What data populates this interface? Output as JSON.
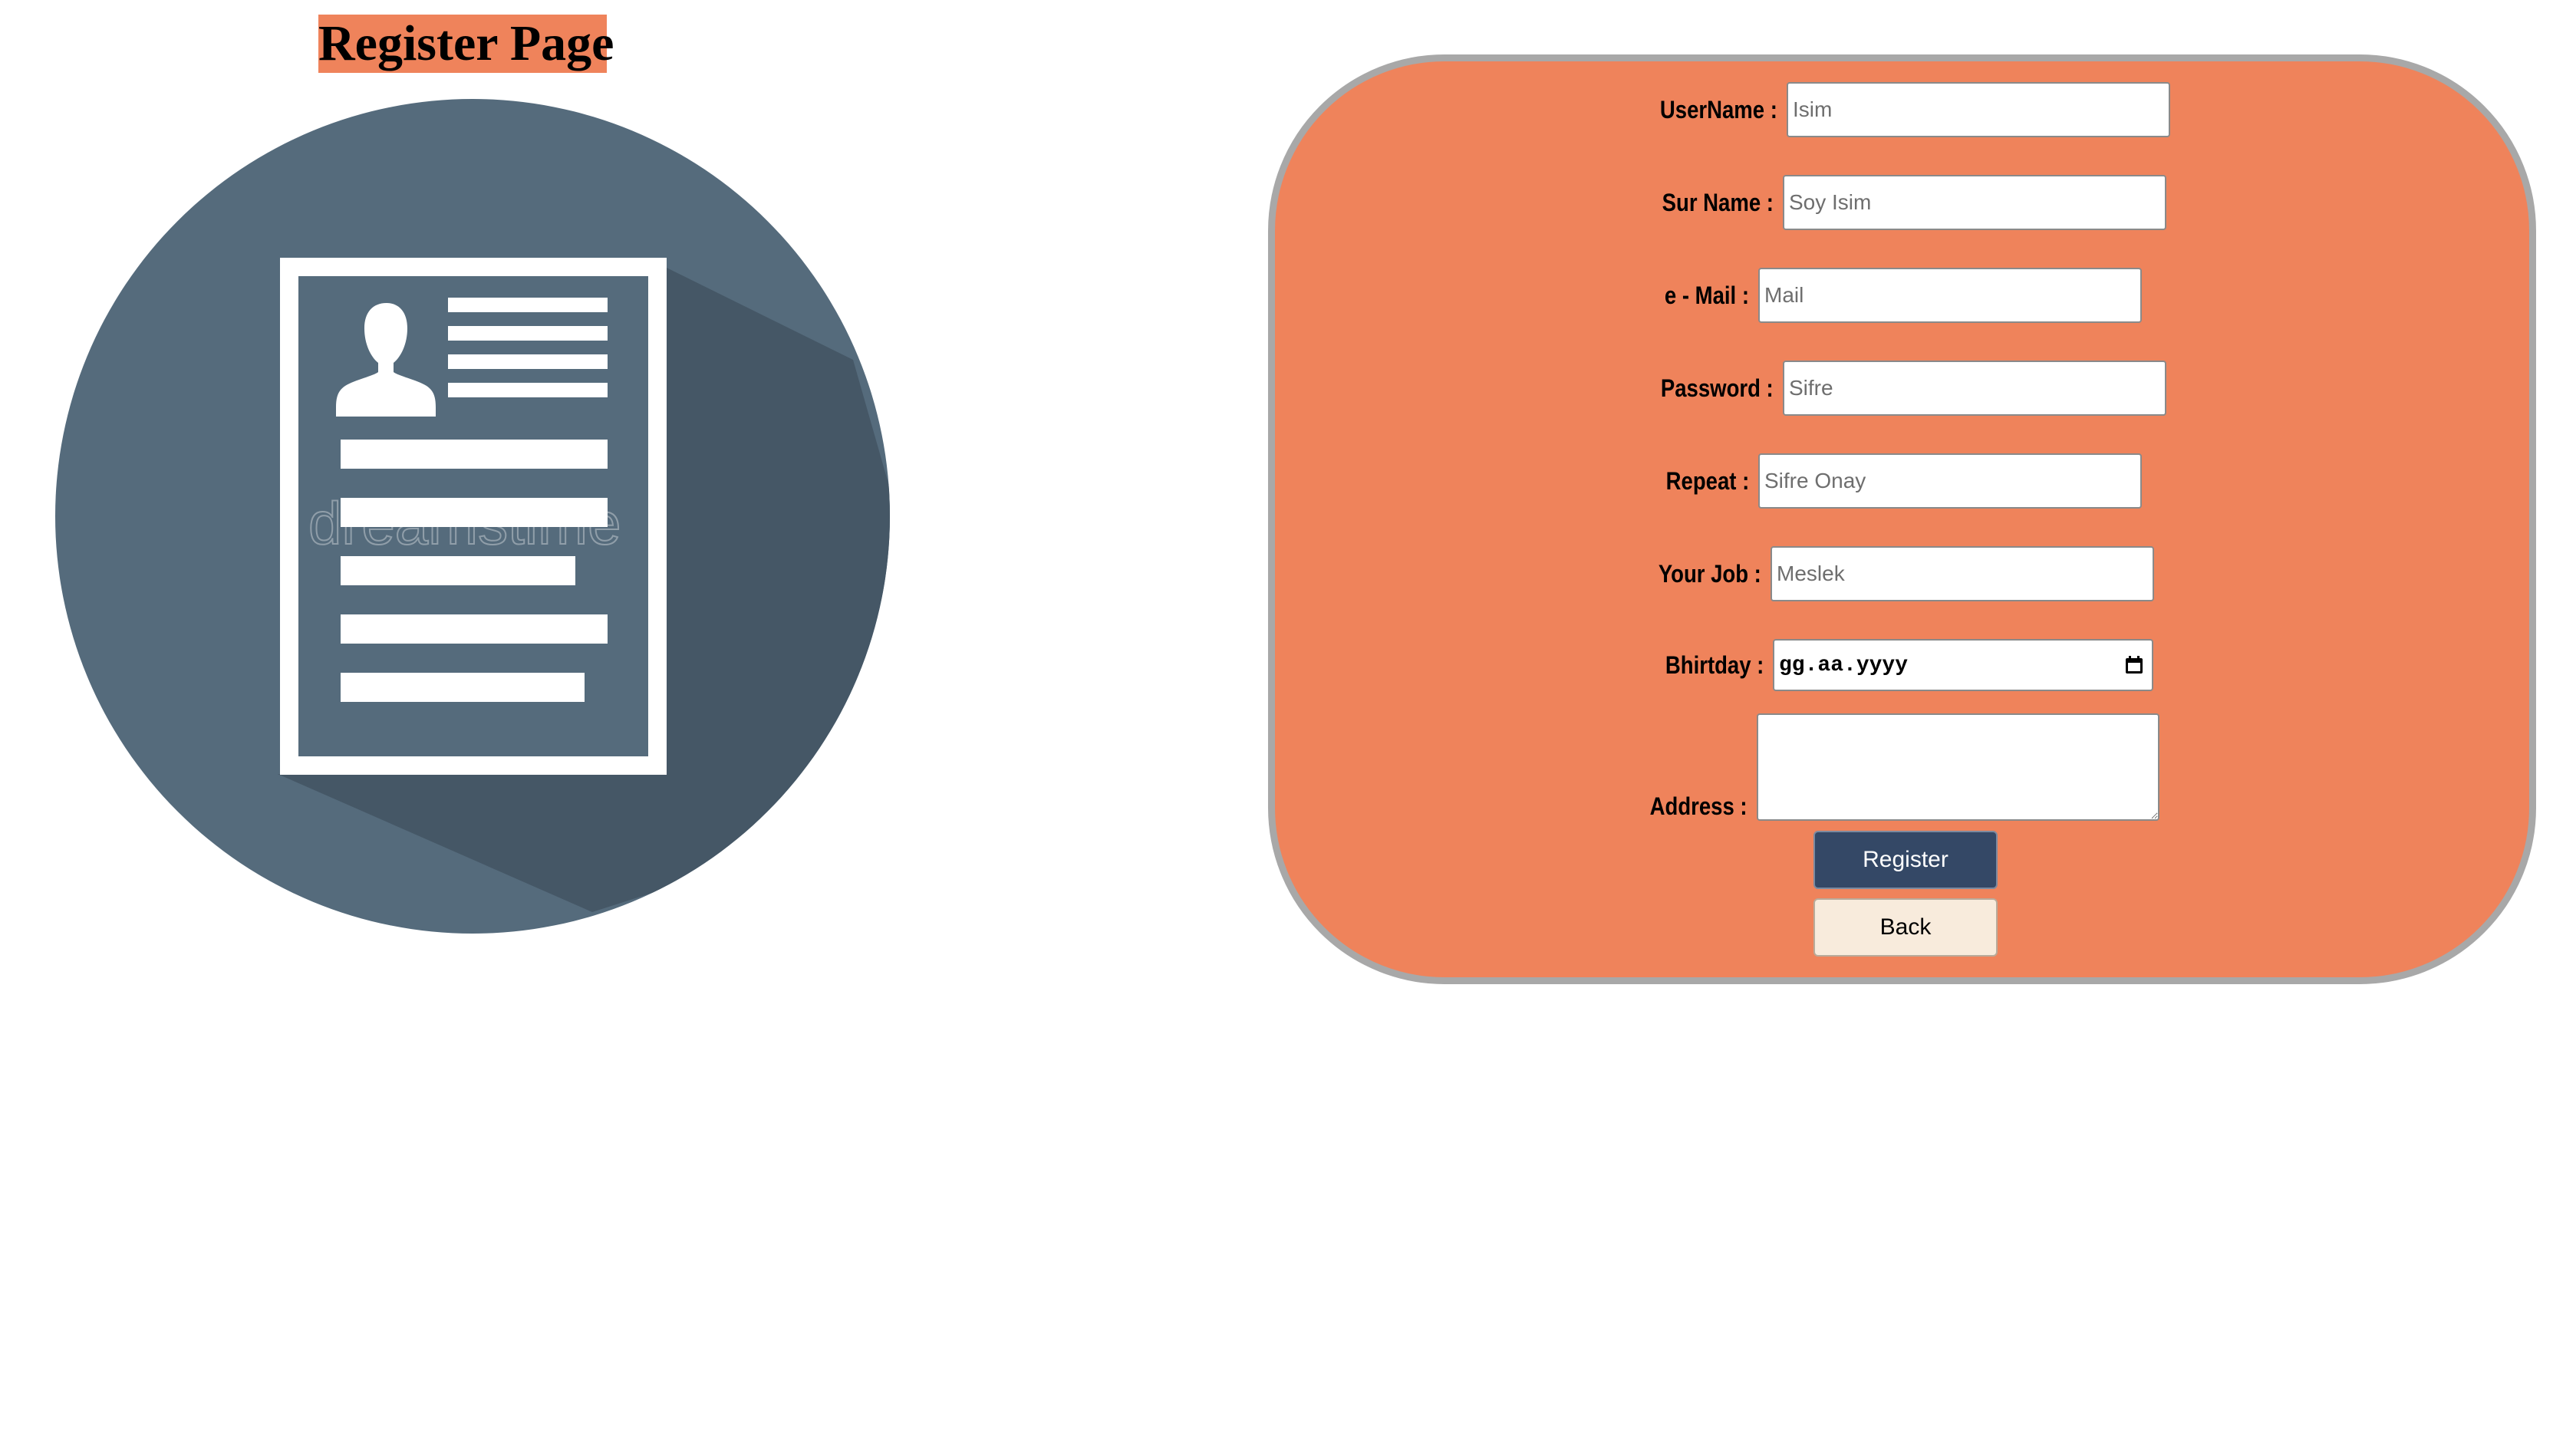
{
  "page": {
    "title": "Register Page"
  },
  "illustration": {
    "icon": "resume-document-icon",
    "watermark": "dreamstime",
    "colors": {
      "circle": "#556b7c",
      "shadow": "#455766",
      "paper": "#ffffff"
    }
  },
  "form": {
    "background": "#ef835b",
    "fields": {
      "username": {
        "label": "UserName :",
        "placeholder": "Isim",
        "value": ""
      },
      "surname": {
        "label": "Sur Name :",
        "placeholder": "Soy Isim",
        "value": ""
      },
      "email": {
        "label": "e - Mail :",
        "placeholder": "Mail",
        "value": ""
      },
      "password": {
        "label": "Password :",
        "placeholder": "Sifre",
        "value": ""
      },
      "repeat": {
        "label": "Repeat :",
        "placeholder": "Sifre Onay",
        "value": ""
      },
      "job": {
        "label": "Your Job :",
        "placeholder": "Meslek",
        "value": ""
      },
      "birthday": {
        "label": "Bhirtday :",
        "display": "gg.aa.yyyy",
        "icon": "calendar-icon"
      },
      "address": {
        "label": "Address :",
        "value": ""
      }
    },
    "buttons": {
      "register": "Register",
      "back": "Back"
    },
    "colors": {
      "register_bg": "#344866",
      "back_bg": "#f8ebdc",
      "card_border": "#a8a8a8"
    }
  }
}
